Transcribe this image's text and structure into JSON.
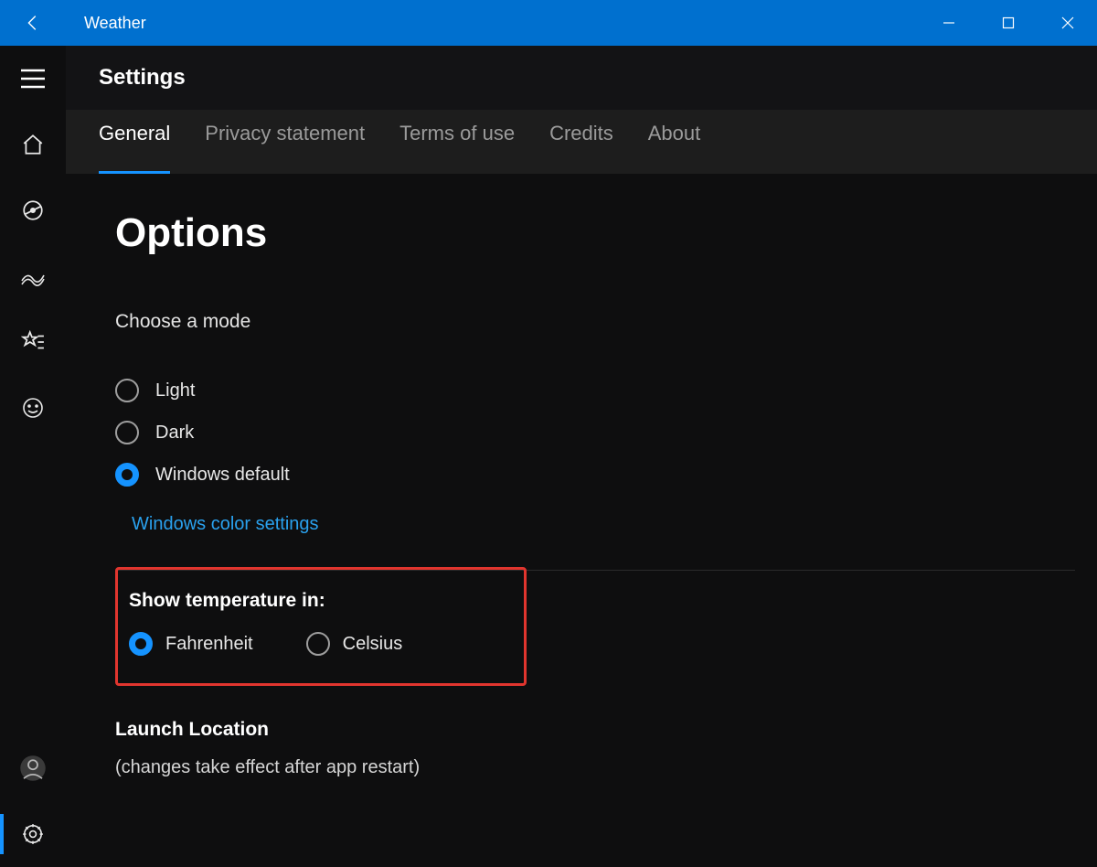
{
  "window": {
    "app_title": "Weather"
  },
  "header": {
    "title": "Settings"
  },
  "tabs": [
    {
      "label": "General",
      "active": true
    },
    {
      "label": "Privacy statement",
      "active": false
    },
    {
      "label": "Terms of use",
      "active": false
    },
    {
      "label": "Credits",
      "active": false
    },
    {
      "label": "About",
      "active": false
    }
  ],
  "options": {
    "title": "Options",
    "mode": {
      "label": "Choose a mode",
      "items": [
        {
          "label": "Light",
          "selected": false
        },
        {
          "label": "Dark",
          "selected": false
        },
        {
          "label": "Windows default",
          "selected": true
        }
      ],
      "link": "Windows color settings"
    },
    "temperature": {
      "heading": "Show temperature in:",
      "items": [
        {
          "label": "Fahrenheit",
          "selected": true
        },
        {
          "label": "Celsius",
          "selected": false
        }
      ]
    },
    "launch": {
      "heading": "Launch Location",
      "note": "(changes take effect after app restart)"
    }
  },
  "colors": {
    "accent": "#1593ff",
    "titlebar": "#0070cf",
    "highlight_border": "#e1352e"
  }
}
